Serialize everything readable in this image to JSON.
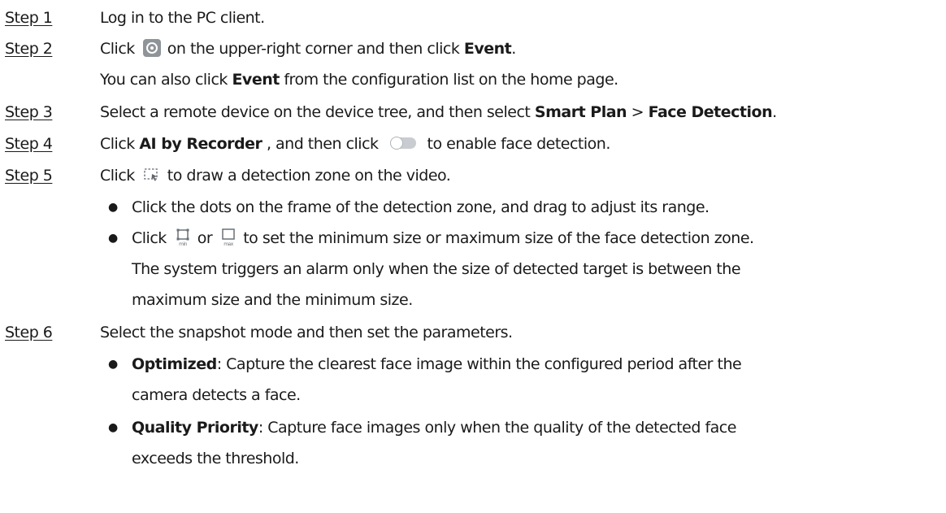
{
  "steps": [
    {
      "label": "Step 1",
      "text": "Log in to the PC client."
    },
    {
      "label": "Step 2",
      "click": "Click",
      "after_icon": "on the upper-right corner and then click",
      "bold": "Event",
      "end": ".",
      "icon": "gear-icon",
      "sub_pre": "You can also click",
      "sub_bold": "Event",
      "sub_post": "from the configuration list on the home page."
    },
    {
      "label": "Step 3",
      "pre": "Select a remote device on the device tree, and then select",
      "bold1": "Smart Plan",
      "mid": ">",
      "bold2": "Face Detection",
      "end": "."
    },
    {
      "label": "Step 4",
      "pre": "Click",
      "bold": "AI by Recorder",
      "mid": ", and then click",
      "post": "to enable face detection.",
      "icon": "toggle-icon"
    },
    {
      "label": "Step 5",
      "pre": "Click",
      "post": "to draw a detection zone on the video.",
      "icon": "draw-zone-icon",
      "bullets": [
        {
          "text": "Click the dots on the frame of the detection zone, and drag to adjust its range."
        },
        {
          "pre": "Click",
          "mid": "or",
          "post": "to set the minimum size or maximum size of the face detection zone.",
          "icon_min": "min-size-icon",
          "icon_min_label": "min",
          "icon_max": "max-size-icon",
          "icon_max_label": "max",
          "cont1": "The system triggers an alarm only when the size of detected target is between the",
          "cont2": "maximum size and the minimum size."
        }
      ]
    },
    {
      "label": "Step 6",
      "text": "Select the snapshot mode and then set the parameters.",
      "bullets": [
        {
          "bold": "Optimized",
          "text": ": Capture the clearest face image within the configured period after the",
          "cont": "camera detects a face."
        },
        {
          "bold": "Quality Priority",
          "text": ": Capture face images only when the quality of the detected face",
          "cont": "exceeds the threshold."
        }
      ]
    }
  ],
  "bullet_char": "●"
}
